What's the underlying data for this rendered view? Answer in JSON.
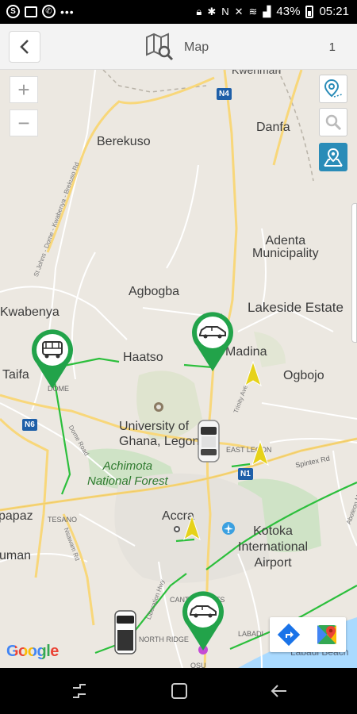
{
  "status_bar": {
    "battery": "43%",
    "time": "05:21",
    "icons": [
      "skype-icon",
      "image-icon",
      "whatsapp-icon",
      "more-dots-icon",
      "lock-icon",
      "bluetooth-icon",
      "nfc-icon",
      "mute-icon",
      "wifi-icon",
      "signal-icon",
      "battery-icon"
    ]
  },
  "header": {
    "back_icon": "chevron-left-icon",
    "map_icon": "map-search-icon",
    "title": "Map",
    "count": "1"
  },
  "map": {
    "zoom_in": "+",
    "zoom_out": "−",
    "place_labels": {
      "kwehman": "Kwehman",
      "danfa": "Danfa",
      "berekuso": "Berekuso",
      "adenta": "Adenta\nMunicipality",
      "agbogba": "Agbogba",
      "lakeside": "Lakeside Estate",
      "kwabenya": "Kwabenya",
      "haatso": "Haatso",
      "madina": "Madina",
      "ogbojo": "Ogbojo",
      "taifa": "Taifa",
      "dome": "DOME",
      "legon": "University of\nGhana, Legon",
      "achimota": "Achimota\nNational Forest",
      "east_legon": "EAST LEGON",
      "apaz": "papaz",
      "tesano": "TESANO",
      "accra": "Accra",
      "kotoka": "Kotoka\nInternational\nAirport",
      "uman": "uman",
      "cantonments": "CANTONMENTS",
      "north_ridge": "NORTH RIDGE",
      "labadi": "LABADI",
      "labadi_beach": "Labadi Beach",
      "osu": "OSU",
      "road_n4": "N4",
      "road_n6": "N6",
      "road_n1": "N1",
      "road_edwei": "Edwei",
      "road_trinity": "Trinity Ave",
      "road_spintex": "Spintex Rd",
      "road_dome": "Dome Road",
      "road_nsawam": "Nsawam Rd",
      "road_liberation": "Liberation Hwy",
      "road_stjohns": "St Johns - Dome - Kwabenya - Brekuso Rd",
      "road_airport": "Aboteon Marina Rd"
    },
    "google_logo": "Google",
    "vehicles": [
      {
        "type": "pin",
        "label": "car-pin"
      },
      {
        "type": "pin",
        "label": "car-pin"
      },
      {
        "type": "pin",
        "label": "car-pin"
      }
    ]
  },
  "colors": {
    "pin_green": "#22a34a",
    "route_green": "#2cbf3c",
    "arrow_yellow": "#e6d21a",
    "teal": "#2a8cb8",
    "shield_blue": "#1e5fa8"
  }
}
